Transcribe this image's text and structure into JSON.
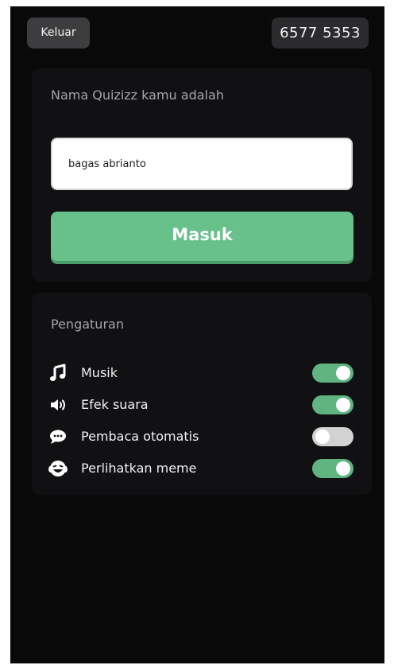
{
  "topbar": {
    "exit_label": "Keluar",
    "game_code": "6577 5353"
  },
  "join": {
    "title": "Nama Quizizz kamu adalah",
    "name_value": "bagas abrianto",
    "submit_label": "Masuk"
  },
  "settings": {
    "title": "Pengaturan",
    "items": [
      {
        "label": "Musik",
        "icon": "music-note-icon",
        "enabled": true
      },
      {
        "label": "Efek suara",
        "icon": "speaker-icon",
        "enabled": true
      },
      {
        "label": "Pembaca otomatis",
        "icon": "chat-bubble-icon",
        "enabled": false
      },
      {
        "label": "Perlihatkan meme",
        "icon": "laughing-face-icon",
        "enabled": true
      }
    ]
  },
  "colors": {
    "background": "#09090a",
    "card": "#111113",
    "accent_green": "#68c08a",
    "toggle_on": "#5fb47f",
    "toggle_off": "#d2d2d2"
  }
}
